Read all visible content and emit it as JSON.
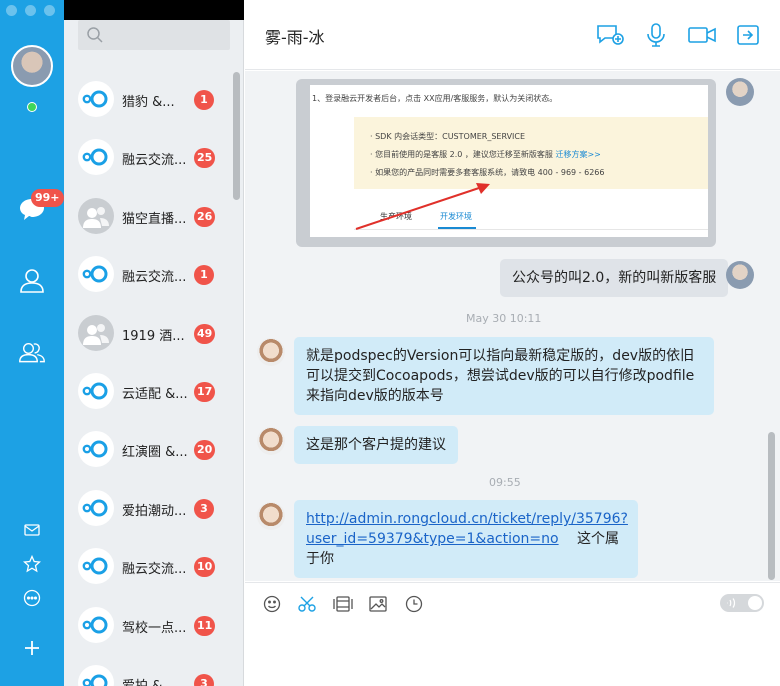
{
  "chat": {
    "title": "雾-雨-冰",
    "messages": {
      "screenshot": {
        "top_text": "1、登录融云开发者后台，点击 XX应用/客服服务，默认为关闭状态。",
        "line1": "· SDK 内会话类型：CUSTOMER_SERVICE",
        "line2": "· 您目前使用的是客服 2.0 ，建议您迁移至新版客服",
        "line2_link": "迁移方案>>",
        "line3": "· 如果您的产品同时需要多套客服系统，请致电 400 - 969 - 6266",
        "tab1": "生产环境",
        "tab2": "开发环境"
      },
      "m1": "公众号的叫2.0，新的叫新版客服",
      "ts1": "May 30  10:11",
      "m2": "就是podspec的Version可以指向最新稳定版的，dev版的依旧可以提交到Cocoapods，想尝试dev版的可以自行修改podfile来指向dev版的版本号",
      "m3": "这是那个客户提的建议",
      "ts2": "09:55",
      "m4_link": "http://admin.rongcloud.cn/ticket/reply/35796?user_id=59379&type=1&action=no",
      "m4_link_l1": "http://admin.rongcloud.cn/ticket/reply/35796?",
      "m4_link_l2": "user_id=59379&type=1&action=no",
      "m4_text": "这个属于你"
    }
  },
  "sidebar": {
    "unread_badge": "99+"
  },
  "conversations": [
    {
      "name": "猎豹 &...",
      "count": "1",
      "avatar": "rong"
    },
    {
      "name": "融云交流...",
      "count": "25",
      "avatar": "rong"
    },
    {
      "name": "猫空直播...",
      "count": "26",
      "avatar": "group"
    },
    {
      "name": "融云交流...",
      "count": "1",
      "avatar": "rong"
    },
    {
      "name": "1919 酒...",
      "count": "49",
      "avatar": "group"
    },
    {
      "name": "云适配 &...",
      "count": "17",
      "avatar": "rong"
    },
    {
      "name": "红演圈 &...",
      "count": "20",
      "avatar": "rong"
    },
    {
      "name": "爱拍潮动...",
      "count": "3",
      "avatar": "rong"
    },
    {
      "name": "融云交流...",
      "count": "10",
      "avatar": "rong"
    },
    {
      "name": "驾校一点...",
      "count": "11",
      "avatar": "rong"
    },
    {
      "name": "爱拍 &...",
      "count": "3",
      "avatar": "rong"
    }
  ],
  "colors": {
    "rail": "#1da1e4",
    "badge": "#f0544a",
    "bubble_other": "#d1ebf8",
    "bubble_me": "#dfe3e8",
    "accent": "#1da1e4"
  },
  "icons": [
    "chat-icon",
    "contact-icon",
    "group-icon",
    "mail-icon",
    "star-icon",
    "more-icon",
    "plus-icon",
    "add-chat-icon",
    "mic-icon",
    "video-icon",
    "share-icon",
    "emoji-icon",
    "scissors-icon",
    "film-icon",
    "image-icon",
    "clock-icon"
  ]
}
